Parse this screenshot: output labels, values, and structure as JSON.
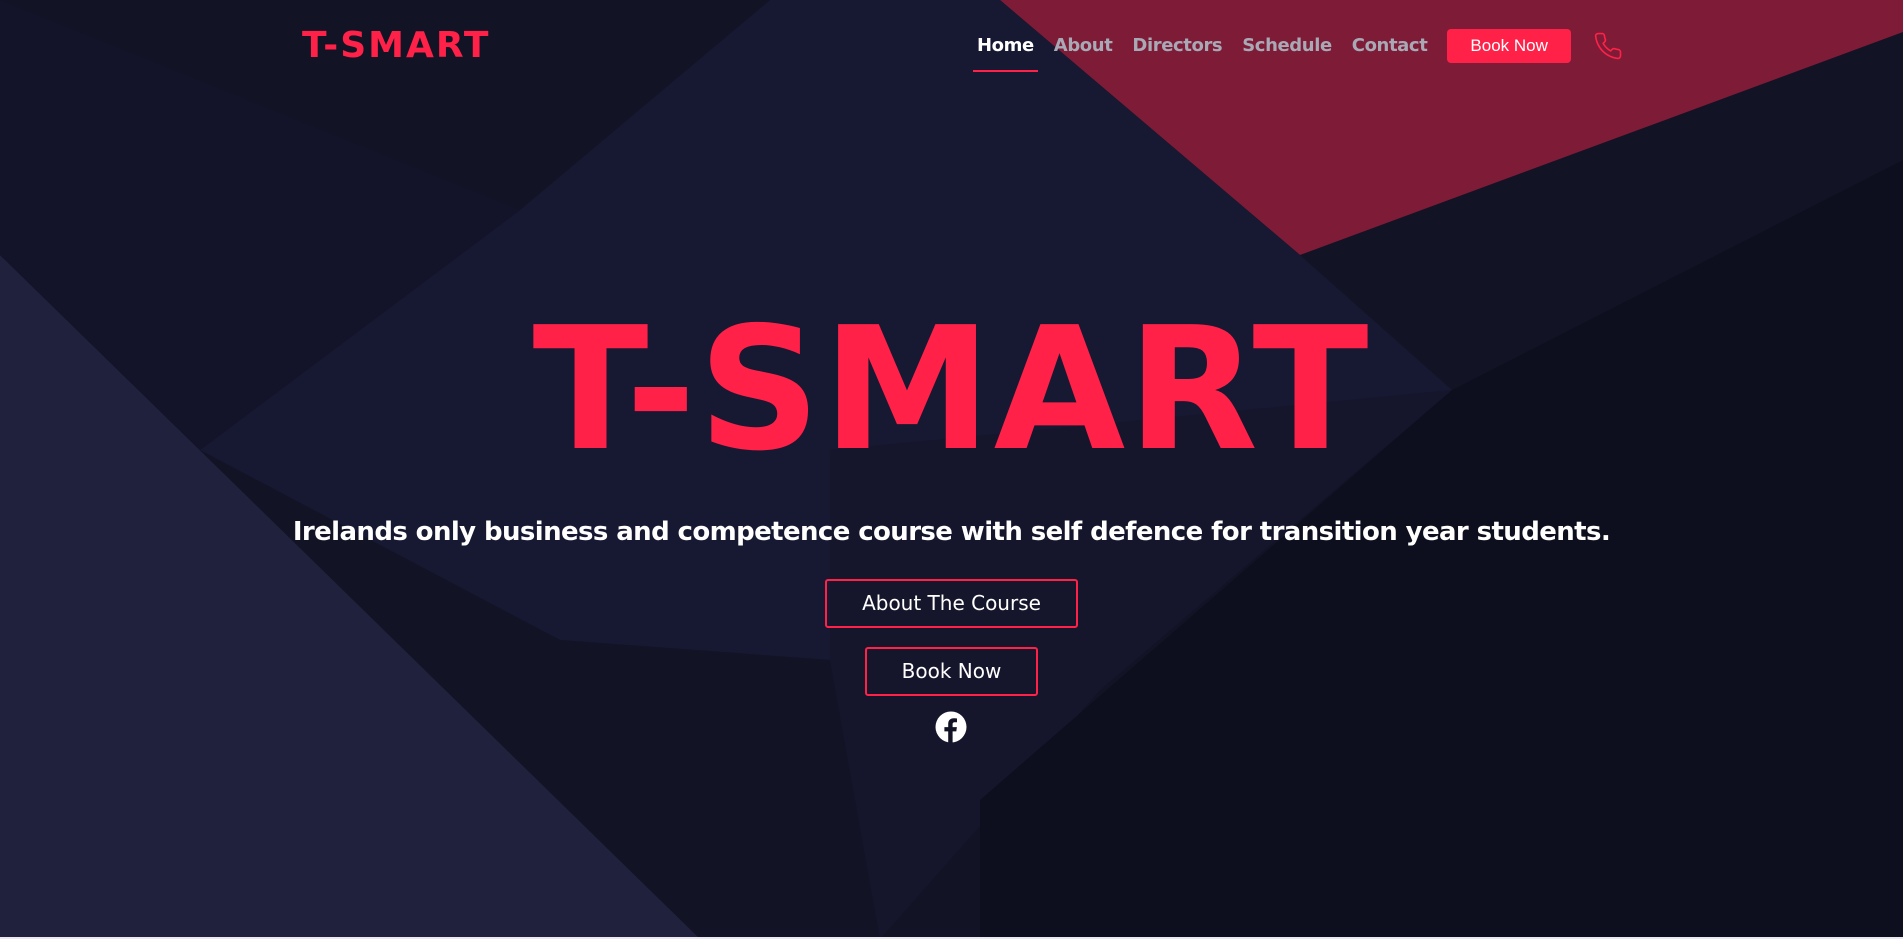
{
  "brand": {
    "logo_text": "T-SMART",
    "accent_color": "#ff2148"
  },
  "nav": {
    "items": [
      {
        "label": "Home",
        "active": true
      },
      {
        "label": "About",
        "active": false
      },
      {
        "label": "Directors",
        "active": false
      },
      {
        "label": "Schedule",
        "active": false
      },
      {
        "label": "Contact",
        "active": false
      }
    ],
    "book_button": "Book Now",
    "phone_icon": "phone-icon"
  },
  "hero": {
    "title": "T-SMART",
    "subtitle": "Irelands only business and competence course with self defence for transition year students.",
    "primary_button": "About The Course",
    "secondary_button": "Book Now",
    "social_icon": "facebook-icon"
  },
  "colors": {
    "background": "#121325",
    "accent": "#ff2148",
    "accent_dark": "#7e1b37",
    "nav_inactive": "#a9a9b6",
    "text": "#ffffff"
  }
}
